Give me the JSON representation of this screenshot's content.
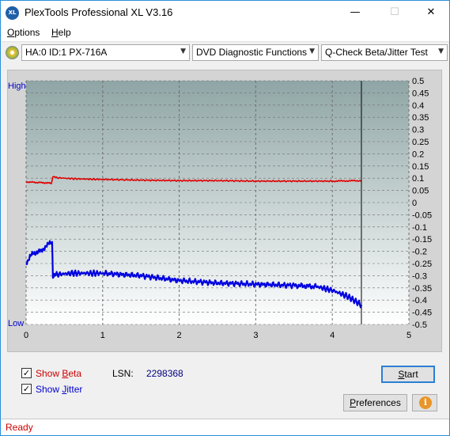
{
  "window": {
    "title": "PlexTools Professional XL V3.16",
    "icon_text": "XL",
    "controls": {
      "minimize": "—",
      "maximize": "☐",
      "close": "✕"
    }
  },
  "menu": {
    "options": {
      "accel": "O",
      "rest": "ptions"
    },
    "help": {
      "accel": "H",
      "rest": "elp"
    }
  },
  "toolbar": {
    "drive": "HA:0 ID:1  PX-716A",
    "function": "DVD Diagnostic Functions",
    "test": "Q-Check Beta/Jitter Test",
    "arrow": "▼"
  },
  "chart_data": {
    "type": "line",
    "left_axis": {
      "top_label": "High",
      "bottom_label": "Low"
    },
    "xlim": [
      0,
      5
    ],
    "x_ticks": [
      "0",
      "1",
      "2",
      "3",
      "4",
      "5"
    ],
    "ylim": [
      -0.5,
      0.5
    ],
    "y_ticks": [
      "0.5",
      "0.45",
      "0.4",
      "0.35",
      "0.3",
      "0.25",
      "0.2",
      "0.15",
      "0.1",
      "0.05",
      "0",
      "-0.05",
      "-0.1",
      "-0.15",
      "-0.2",
      "-0.25",
      "-0.3",
      "-0.35",
      "-0.4",
      "-0.45",
      "-0.5"
    ],
    "end_marker_x": 4.38,
    "series": [
      {
        "color": "#e00000",
        "x": [
          0.0,
          0.1,
          0.2,
          0.3,
          0.33,
          0.35,
          0.4,
          0.6,
          0.8,
          1.0,
          1.5,
          2.0,
          2.5,
          3.0,
          3.5,
          4.0,
          4.38
        ],
        "values": [
          0.085,
          0.083,
          0.082,
          0.08,
          0.078,
          0.108,
          0.102,
          0.098,
          0.096,
          0.095,
          0.092,
          0.09,
          0.09,
          0.088,
          0.088,
          0.088,
          0.09
        ]
      },
      {
        "color": "#0000e0",
        "x": [
          0.0,
          0.05,
          0.1,
          0.15,
          0.2,
          0.25,
          0.3,
          0.34,
          0.35,
          0.4,
          0.6,
          0.8,
          1.0,
          1.5,
          2.0,
          2.5,
          3.0,
          3.5,
          3.8,
          4.0,
          4.2,
          4.38
        ],
        "values": [
          -0.25,
          -0.22,
          -0.21,
          -0.2,
          -0.2,
          -0.18,
          -0.17,
          -0.16,
          -0.3,
          -0.295,
          -0.29,
          -0.29,
          -0.29,
          -0.3,
          -0.32,
          -0.33,
          -0.335,
          -0.34,
          -0.345,
          -0.36,
          -0.385,
          -0.42
        ]
      }
    ],
    "colors": {
      "plot_top": "#8fa5a5",
      "plot_bottom": "#ffffff",
      "grid": "#6f6f6f",
      "frame": "#d4d4d4"
    }
  },
  "controls": {
    "show_beta": {
      "checked": "✓",
      "accel": "B",
      "label_pre": "Show ",
      "label_post": "eta",
      "color": "#cc0000"
    },
    "show_jitter": {
      "checked": "✓",
      "accel": "J",
      "label_pre": "Show ",
      "label_post": "itter",
      "color": "#0000cc"
    },
    "lsn_label": "LSN:",
    "lsn_value": "2298368",
    "start": {
      "accel": "S",
      "rest": "tart"
    },
    "preferences": {
      "accel": "P",
      "rest": "references"
    },
    "info_icon": "i"
  },
  "status": {
    "text": "Ready"
  }
}
